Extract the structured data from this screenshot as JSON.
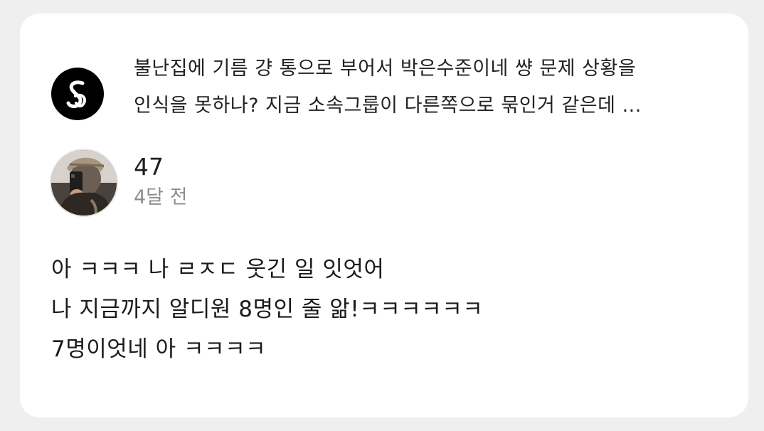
{
  "quoted_post": {
    "logo_icon": "script-s-logo-icon",
    "text_lines": [
      "불난집에 기름 걍 통으로 부어서 박은수준이네 썅 문제 상황을",
      "인식을 못하나? 지금 소속그룹이 다른쪽으로 묶인거 같은데 ..."
    ]
  },
  "comment": {
    "author": {
      "avatar_icon": "profile-photo-avatar",
      "name": "47",
      "time": "4달 전"
    },
    "body_lines": [
      "아 ㅋㅋㅋ 나 ㄹㅈㄷ 웃긴 일 잇엇어",
      "나 지금까지 알디원 8명인 줄 앎!ㅋㅋㅋㅋㅋㅋ",
      "7명이엇네 아 ㅋㅋㅋㅋ"
    ]
  },
  "colors": {
    "background": "#efefef",
    "card": "#ffffff",
    "text": "#1b1b1b",
    "muted": "#8e8e8e",
    "logo": "#000000"
  }
}
